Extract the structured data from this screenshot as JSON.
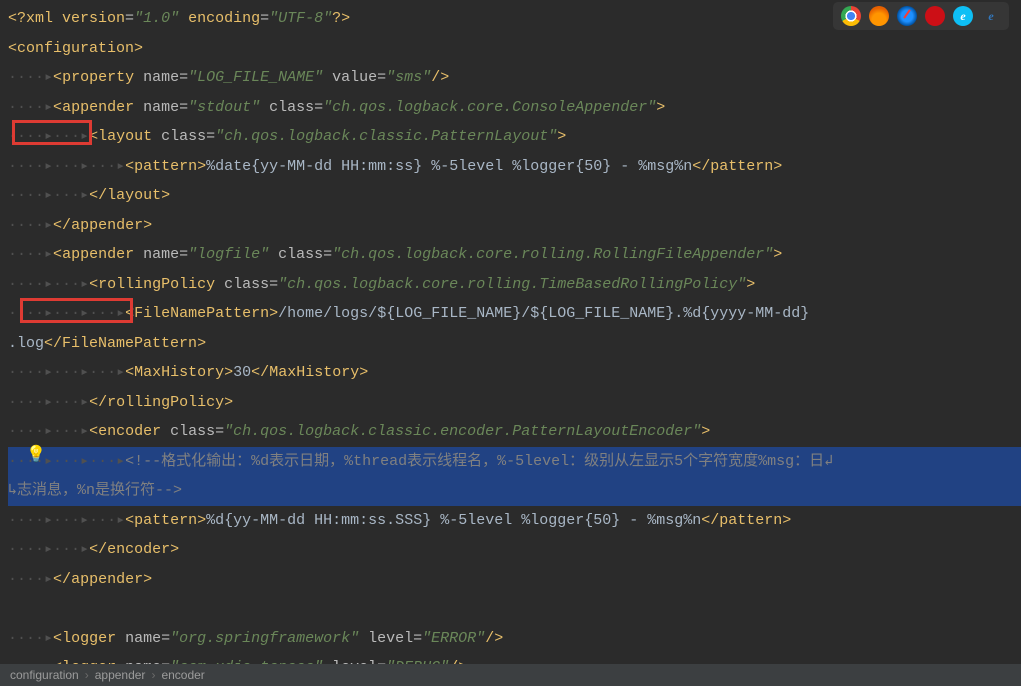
{
  "lines": {
    "l1a": "<?",
    "l1b": "xml version",
    "l1c": "=",
    "l1d": "\"1.0\"",
    "l1e": " encoding",
    "l1f": "=",
    "l1g": "\"UTF-8\"",
    "l1h": "?>",
    "l2a": "<",
    "l2b": "configuration",
    "l2c": ">",
    "ws1": "····▸",
    "l3a": "<",
    "l3b": "property ",
    "l3c": "name",
    "l3d": "=",
    "l3e": "\"LOG_FILE_NAME\"",
    "l3f": " value",
    "l3g": "=",
    "l3h": "\"sms\"",
    "l3i": "/>",
    "l4a": "<",
    "l4b": "appender ",
    "l4c": "name",
    "l4d": "=",
    "l4e": "\"stdout\"",
    "l4f": " class",
    "l4g": "=",
    "l4h": "\"ch.qos.logback.core.ConsoleAppender\"",
    "l4i": ">",
    "ws2": "····▸···▸",
    "l5a": "<",
    "l5b": "layout ",
    "l5c": "class",
    "l5d": "=",
    "l5e": "\"ch.qos.logback.classic.PatternLayout\"",
    "l5f": ">",
    "ws3": "····▸···▸···▸",
    "l6a": "<",
    "l6b": "pattern",
    "l6c": ">",
    "l6d": "%date{yy-MM-dd HH:mm:ss} %-5level %logger{50} - %msg%n",
    "l6e": "</",
    "l6f": "pattern",
    "l6g": ">",
    "l7a": "</",
    "l7b": "layout",
    "l7c": ">",
    "l8a": "</",
    "l8b": "appender",
    "l8c": ">",
    "l9a": "<",
    "l9b": "appender ",
    "l9c": "name",
    "l9d": "=",
    "l9e": "\"logfile\"",
    "l9f": " class",
    "l9g": "=",
    "l9h": "\"ch.qos.logback.core.rolling.RollingFileAppender\"",
    "l9i": ">",
    "l10a": "<",
    "l10b": "rollingPolicy ",
    "l10c": "class",
    "l10d": "=",
    "l10e": "\"ch.qos.logback.core.rolling.TimeBasedRollingPolicy\"",
    "l10f": ">",
    "l11a": "<",
    "l11b": "FileNamePattern",
    "l11c": ">",
    "l11d": "/home/logs/${LOG_FILE_NAME}/${LOG_FILE_NAME}.%d{yyyy-MM-dd}",
    "l11e": ".log",
    "l11f": "</",
    "l11g": "FileNamePattern",
    "l11h": ">",
    "l12a": "<",
    "l12b": "MaxHistory",
    "l12c": ">",
    "l12d": "30",
    "l12e": "</",
    "l12f": "MaxHistory",
    "l12g": ">",
    "l13a": "</",
    "l13b": "rollingPolicy",
    "l13c": ">",
    "l14a": "<",
    "l14b": "encoder ",
    "l14c": "class",
    "l14d": "=",
    "l14e": "\"ch.qos.logback.classic.encoder.PatternLayoutEncoder\"",
    "l14f": ">",
    "l15a": "<!--格式化输出：%d表示日期，%thread表示线程名，%-5level：级别从左显示5个字符宽度%msg：日",
    "l15b": "志消息，%n是换行符-->",
    "l16d": "%d{yy-MM-dd HH:mm:ss.SSS} %-5level %logger{50} - %msg%n",
    "l17a": "</",
    "l17b": "encoder",
    "l17c": ">",
    "l19a": "<",
    "l19b": "logger ",
    "l19c": "name",
    "l19d": "=",
    "l19e": "\"org.springframework\"",
    "l19f": " level",
    "l19g": "=",
    "l19h": "\"ERROR\"",
    "l19i": "/>",
    "l20a": "<",
    "l20b": "logger ",
    "l20c": "name",
    "l20d": "=",
    "l20e": "\"com.xdja.topsec\"",
    "l20f": " level",
    "l20g": "=",
    "l20h": "\"DEBUG\"",
    "l20i": "/>"
  },
  "breadcrumb": {
    "a": "configuration",
    "b": "appender",
    "c": "encoder"
  },
  "icons": {
    "ie": "e",
    "edge": "e"
  },
  "wrap": "↲",
  "wrapL": "↳"
}
